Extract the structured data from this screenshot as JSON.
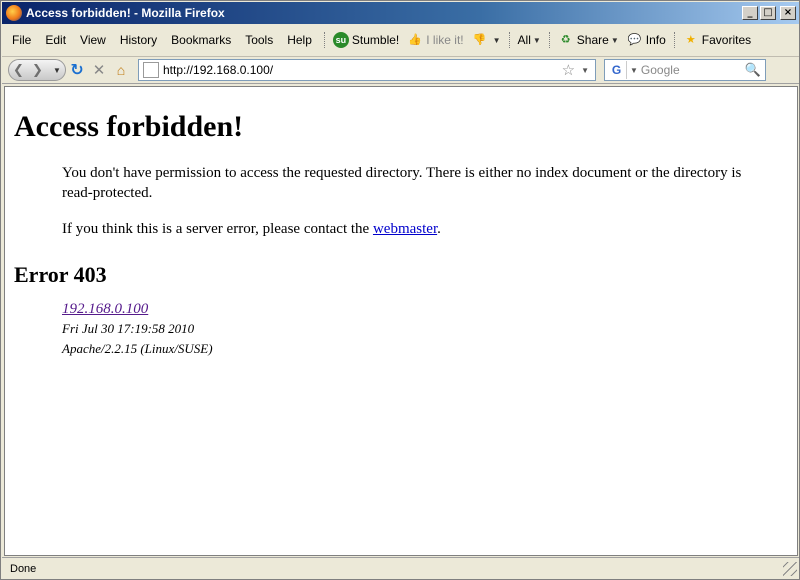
{
  "window": {
    "title": "Access forbidden! - Mozilla Firefox",
    "min_glyph": "_",
    "max_glyph": "□",
    "close_glyph": "×"
  },
  "menu": {
    "items": [
      "File",
      "Edit",
      "View",
      "History",
      "Bookmarks",
      "Tools",
      "Help"
    ]
  },
  "toolbar": {
    "stumble_label": "Stumble!",
    "ilike_label": "I like it!",
    "all_label": "All",
    "share_label": "Share",
    "info_label": "Info",
    "favorites_label": "Favorites"
  },
  "nav": {
    "url": "http://192.168.0.100/",
    "search_placeholder": "Google"
  },
  "page": {
    "heading": "Access forbidden!",
    "paragraph1": "You don't have permission to access the requested directory. There is either no index document or the directory is read-protected.",
    "paragraph2_prefix": "If you think this is a server error, please contact the",
    "paragraph2_link": "webmaster",
    "paragraph2_suffix": ".",
    "error_heading": "Error 403",
    "address_link": "192.168.0.100",
    "timestamp": "Fri Jul 30 17:19:58 2010",
    "server": "Apache/2.2.15 (Linux/SUSE)"
  },
  "status": {
    "text": "Done"
  },
  "icons": {
    "app": "firefox-icon",
    "stumble": "stumbleupon-icon",
    "ilike": "thumbs-up-icon",
    "dislike": "thumbs-down-icon",
    "share": "share-icon",
    "info": "info-bubble-icon",
    "favorites": "star-icon"
  }
}
